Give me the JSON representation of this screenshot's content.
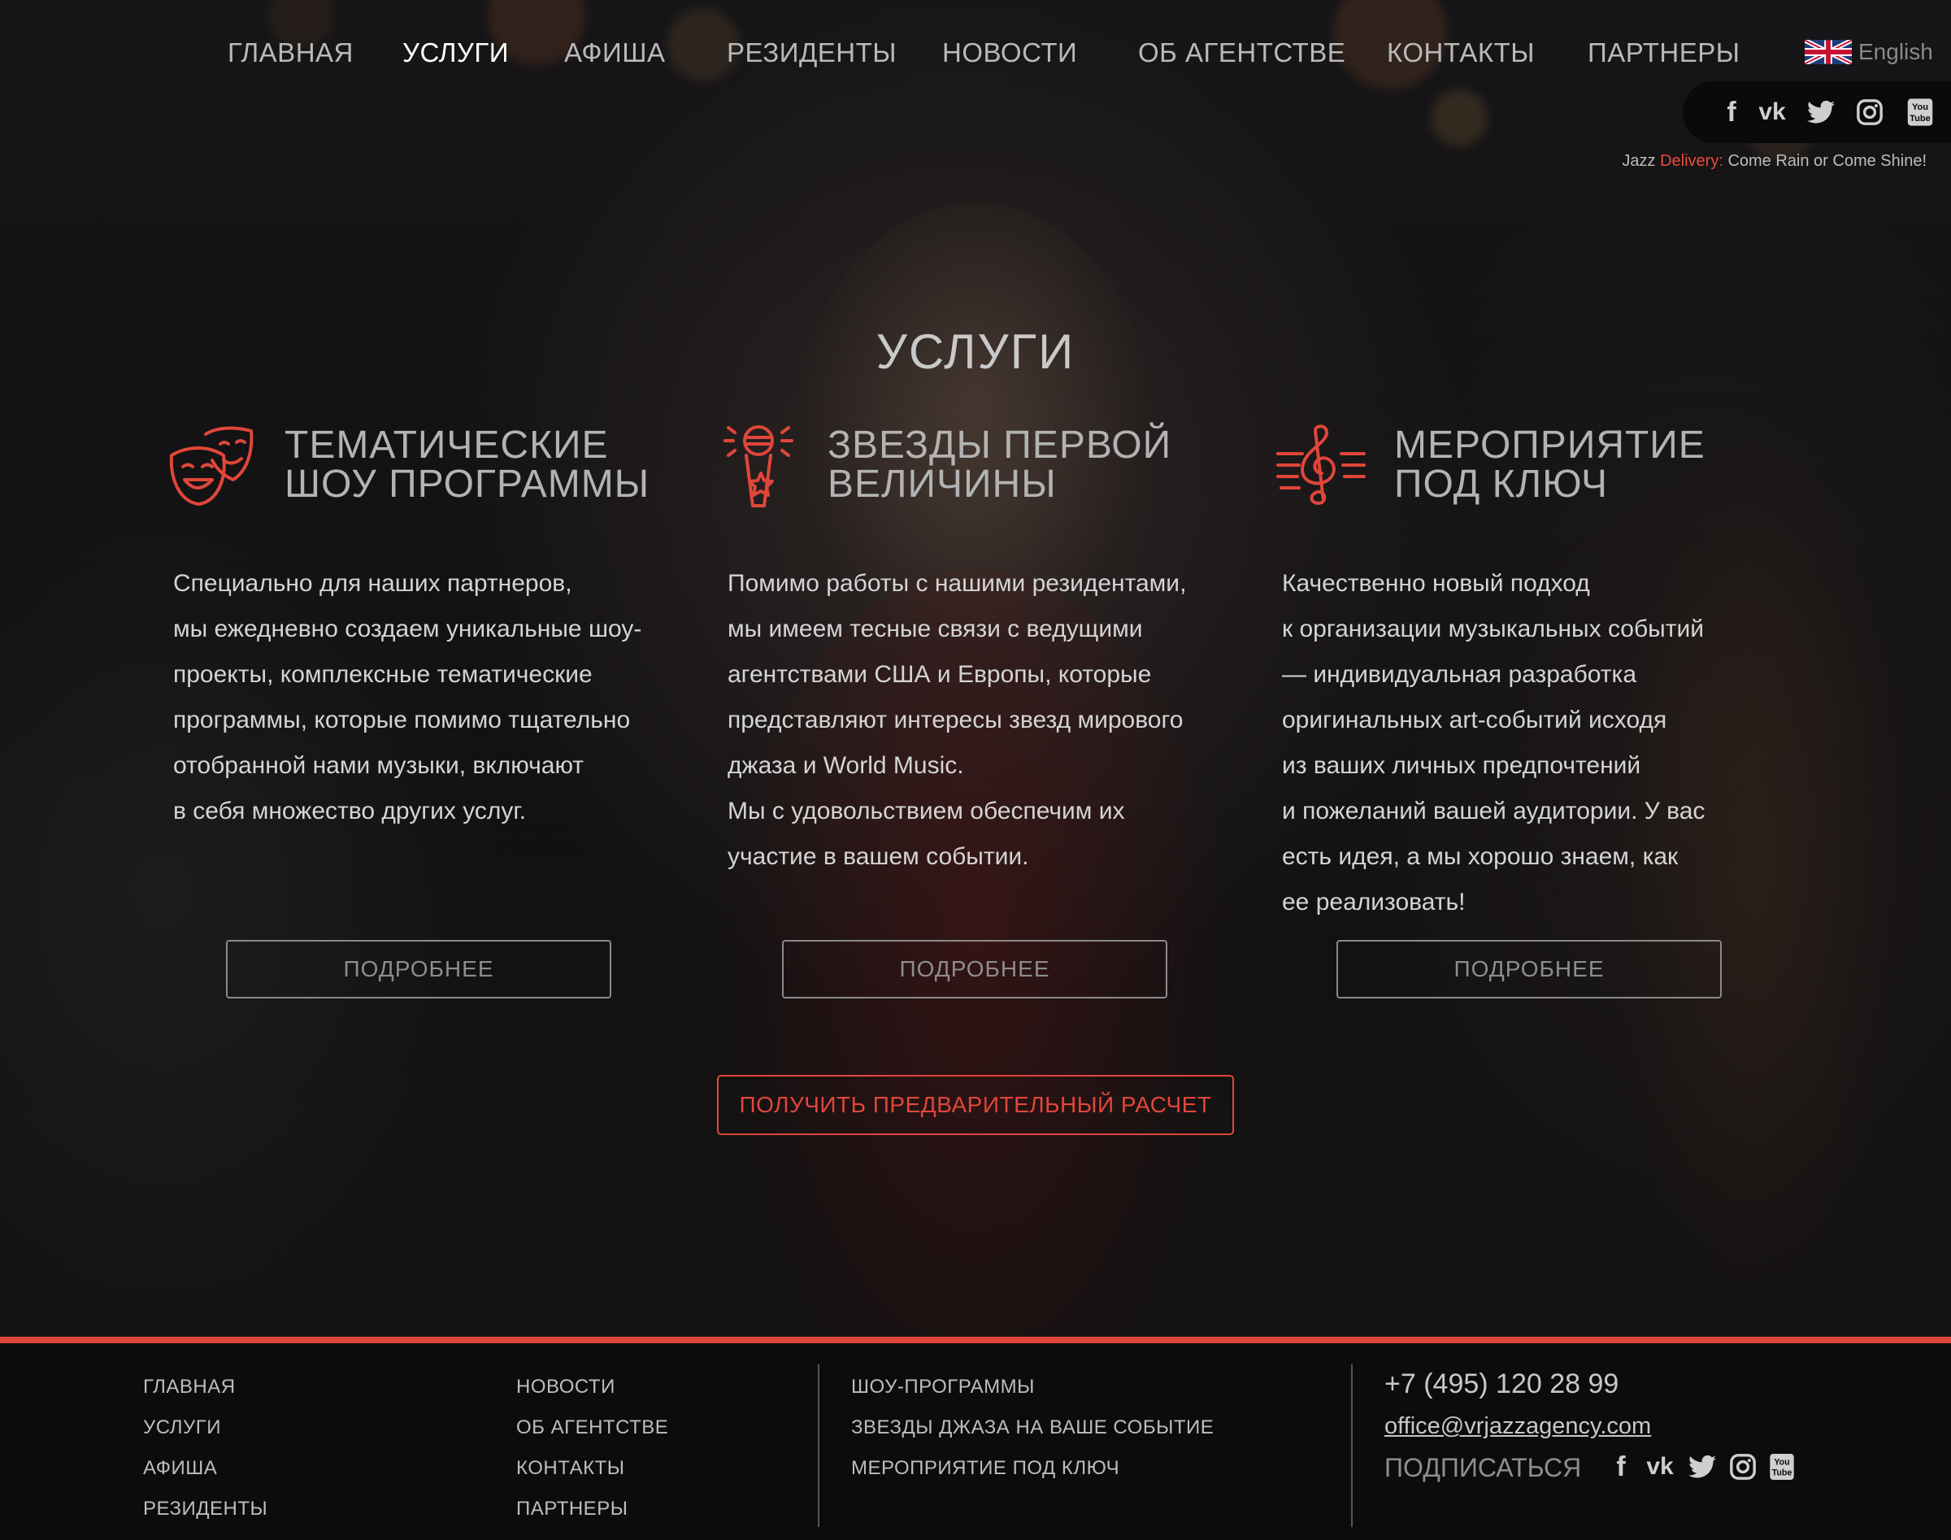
{
  "nav": {
    "items": [
      {
        "label": "ГЛАВНАЯ",
        "active": false
      },
      {
        "label": "УСЛУГИ",
        "active": true
      },
      {
        "label": "АФИША",
        "active": false
      },
      {
        "label": "РЕЗИДЕНТЫ",
        "active": false
      },
      {
        "label": "НОВОСТИ",
        "active": false
      },
      {
        "label": "ОБ АГЕНТСТВЕ",
        "active": false
      },
      {
        "label": "КОНТАКТЫ",
        "active": false
      },
      {
        "label": "ПАРТНЕРЫ",
        "active": false
      }
    ],
    "language": "English"
  },
  "social": {
    "icons": [
      "facebook-icon",
      "vk-icon",
      "twitter-icon",
      "instagram-icon",
      "youtube-icon"
    ],
    "youtube_text": "You Tube"
  },
  "tagline": {
    "prefix": "Jazz ",
    "highlight": "Delivery:",
    "suffix": " Come Rain or Come Shine!"
  },
  "page_title": "УСЛУГИ",
  "services": [
    {
      "icon": "theater-masks-icon",
      "title_line1": "ТЕМАТИЧЕСКИЕ",
      "title_line2": "ШОУ ПРОГРАММЫ",
      "text": [
        "Специально для наших партнеров,",
        "мы ежедневно создаем уникальные шоу-",
        "проекты, комплексные тематические",
        "программы, которые помимо тщательно",
        "отобранной нами музыки, включают",
        "в себя множество других услуг."
      ],
      "button": "ПОДРОБНЕЕ"
    },
    {
      "icon": "microphone-star-icon",
      "title_line1": "ЗВЕЗДЫ ПЕРВОЙ",
      "title_line2": "ВЕЛИЧИНЫ",
      "text": [
        "Помимо работы с нашими резидентами,",
        "мы имеем тесные связи с ведущими",
        "агентствами США и Европы, которые",
        "представляют интересы звезд мирового",
        "джаза и  World Music.",
        "Мы с удовольствием обеспечим их",
        "участие в вашем событии."
      ],
      "button": "ПОДРОБНЕЕ"
    },
    {
      "icon": "treble-clef-icon",
      "title_line1": "МЕРОПРИЯТИЕ",
      "title_line2": "ПОД КЛЮЧ",
      "text": [
        "Качественно новый подход",
        "к организации музыкальных событий",
        "— индивидуальная разработка",
        "оригинальных art-событий исходя",
        "из ваших личных предпочтений",
        "и пожеланий вашей аудитории. У вас",
        "есть идея, а мы хорошо знаем, как",
        "ее реализовать!"
      ],
      "button": "ПОДРОБНЕЕ"
    }
  ],
  "calc_button": "ПОЛУЧИТЬ ПРЕДВАРИТЕЛЬНЫЙ РАСЧЕТ",
  "footer": {
    "col1": [
      "ГЛАВНАЯ",
      "УСЛУГИ",
      "АФИША",
      "РЕЗИДЕНТЫ"
    ],
    "col2": [
      "НОВОСТИ",
      "ОБ АГЕНТСТВЕ",
      "КОНТАКТЫ",
      "ПАРТНЕРЫ"
    ],
    "col3": [
      "ШОУ-ПРОГРАММЫ",
      "ЗВЕЗДЫ ДЖАЗА НА ВАШЕ СОБЫТИЕ",
      "МЕРОПРИЯТИЕ ПОД КЛЮЧ"
    ],
    "phone": "+7 (495) 120 28 99",
    "email": "office@vrjazzagency.com",
    "subscribe": "ПОДПИСАТЬСЯ"
  },
  "colors": {
    "accent": "#e0463a",
    "background": "#0b0b0c",
    "text": "#d4d4d4"
  }
}
